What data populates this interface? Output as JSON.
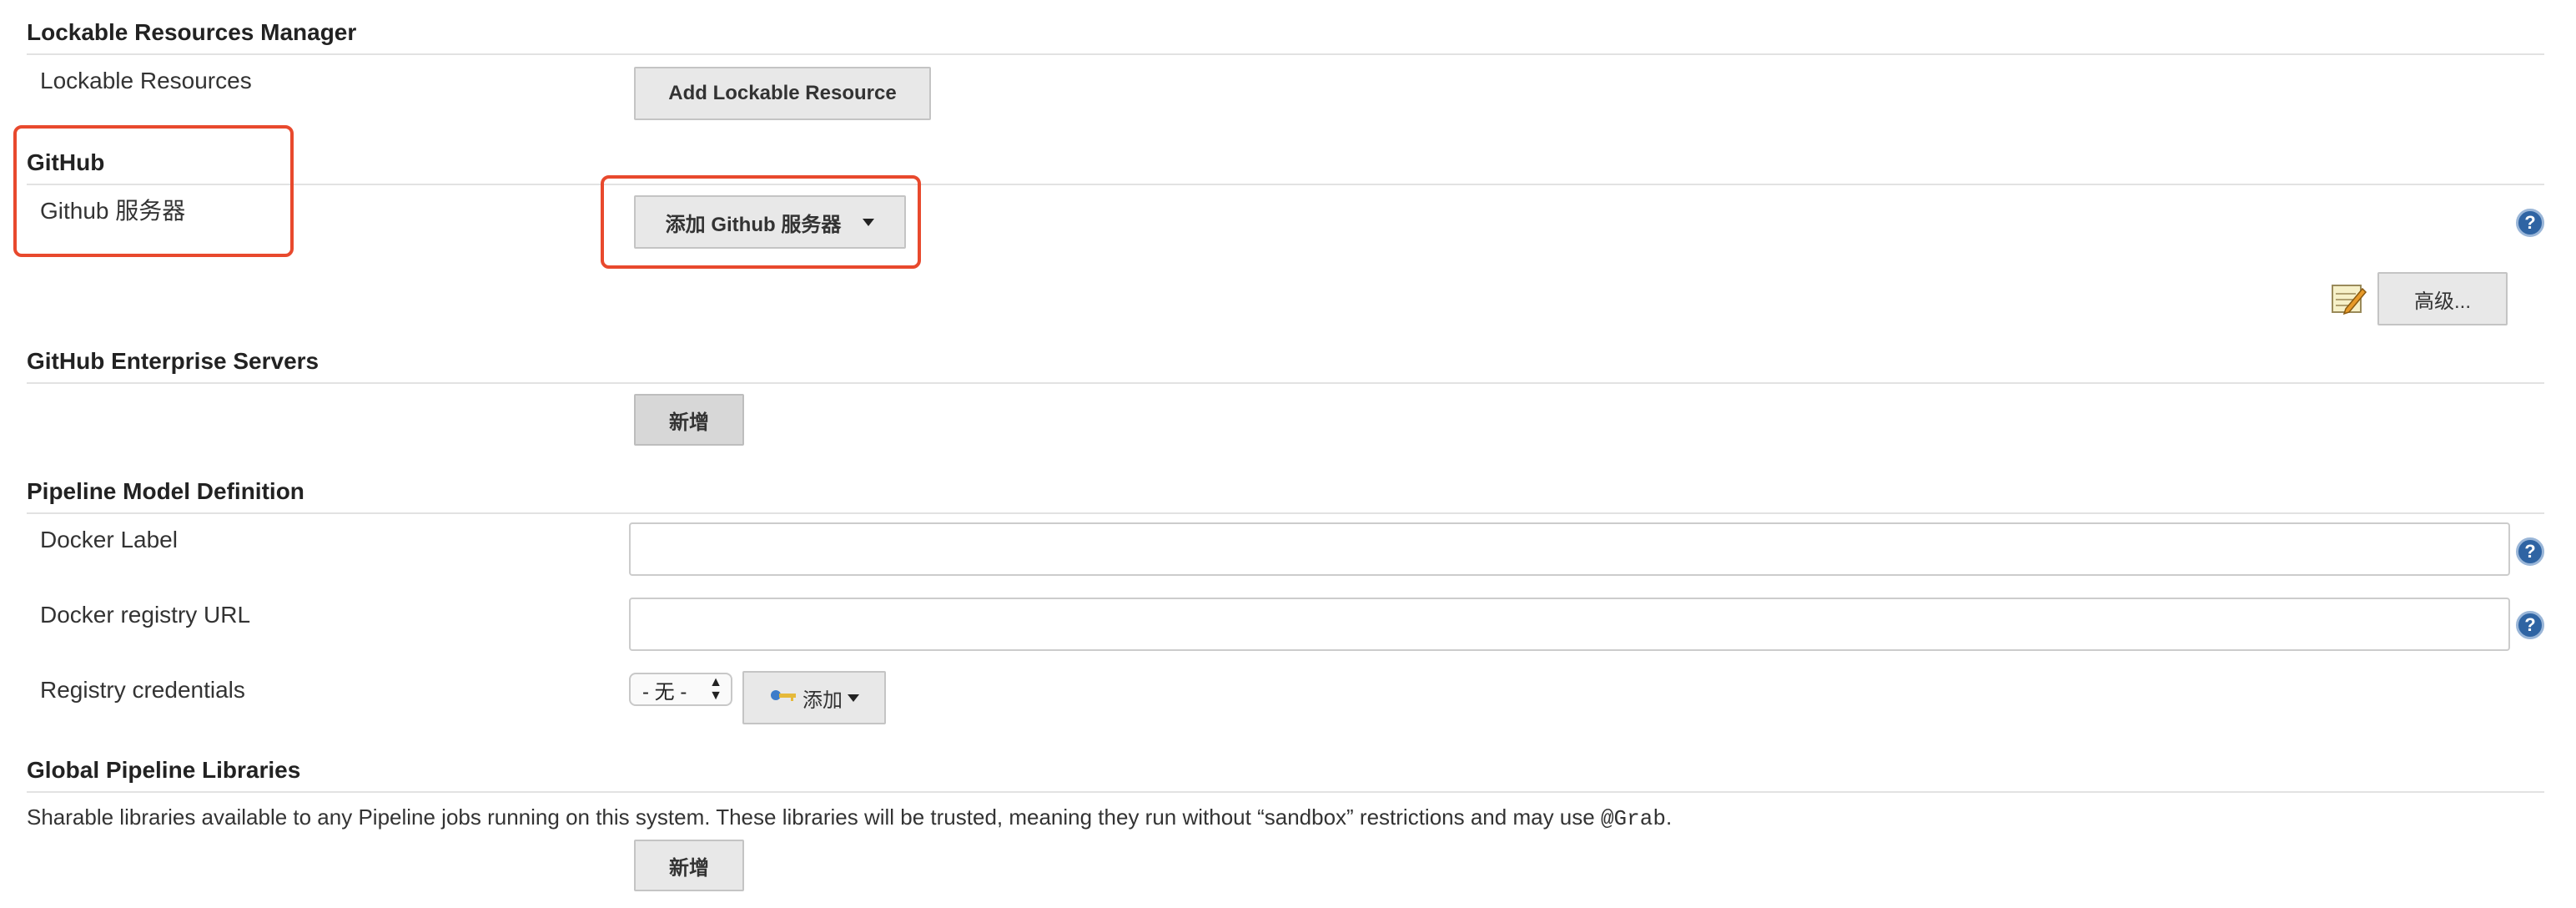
{
  "lockable": {
    "header": "Lockable Resources Manager",
    "row_label": "Lockable Resources",
    "add_button": "Add Lockable Resource"
  },
  "github": {
    "header": "GitHub",
    "row_label": "Github 服务器",
    "add_server_button": "添加 Github 服务器",
    "advanced_button": "高级..."
  },
  "enterprise": {
    "header": "GitHub Enterprise Servers",
    "add_button": "新增"
  },
  "pipeline_model": {
    "header": "Pipeline Model Definition",
    "docker_label": {
      "label": "Docker Label",
      "value": ""
    },
    "docker_registry_url": {
      "label": "Docker registry URL",
      "value": ""
    },
    "registry_credentials": {
      "label": "Registry credentials",
      "selected": "- 无 -",
      "add_button": "添加"
    }
  },
  "global_libraries": {
    "header": "Global Pipeline Libraries",
    "description_prefix": "Sharable libraries available to any Pipeline jobs running on this system. These libraries will be trusted, meaning they run without “sandbox” restrictions and may use ",
    "description_code": "@Grab",
    "description_suffix": ".",
    "add_button": "新增"
  },
  "colors": {
    "highlight": "#e8492d",
    "help_icon": "#2f64a3",
    "button_bg": "#e8e8e8"
  }
}
